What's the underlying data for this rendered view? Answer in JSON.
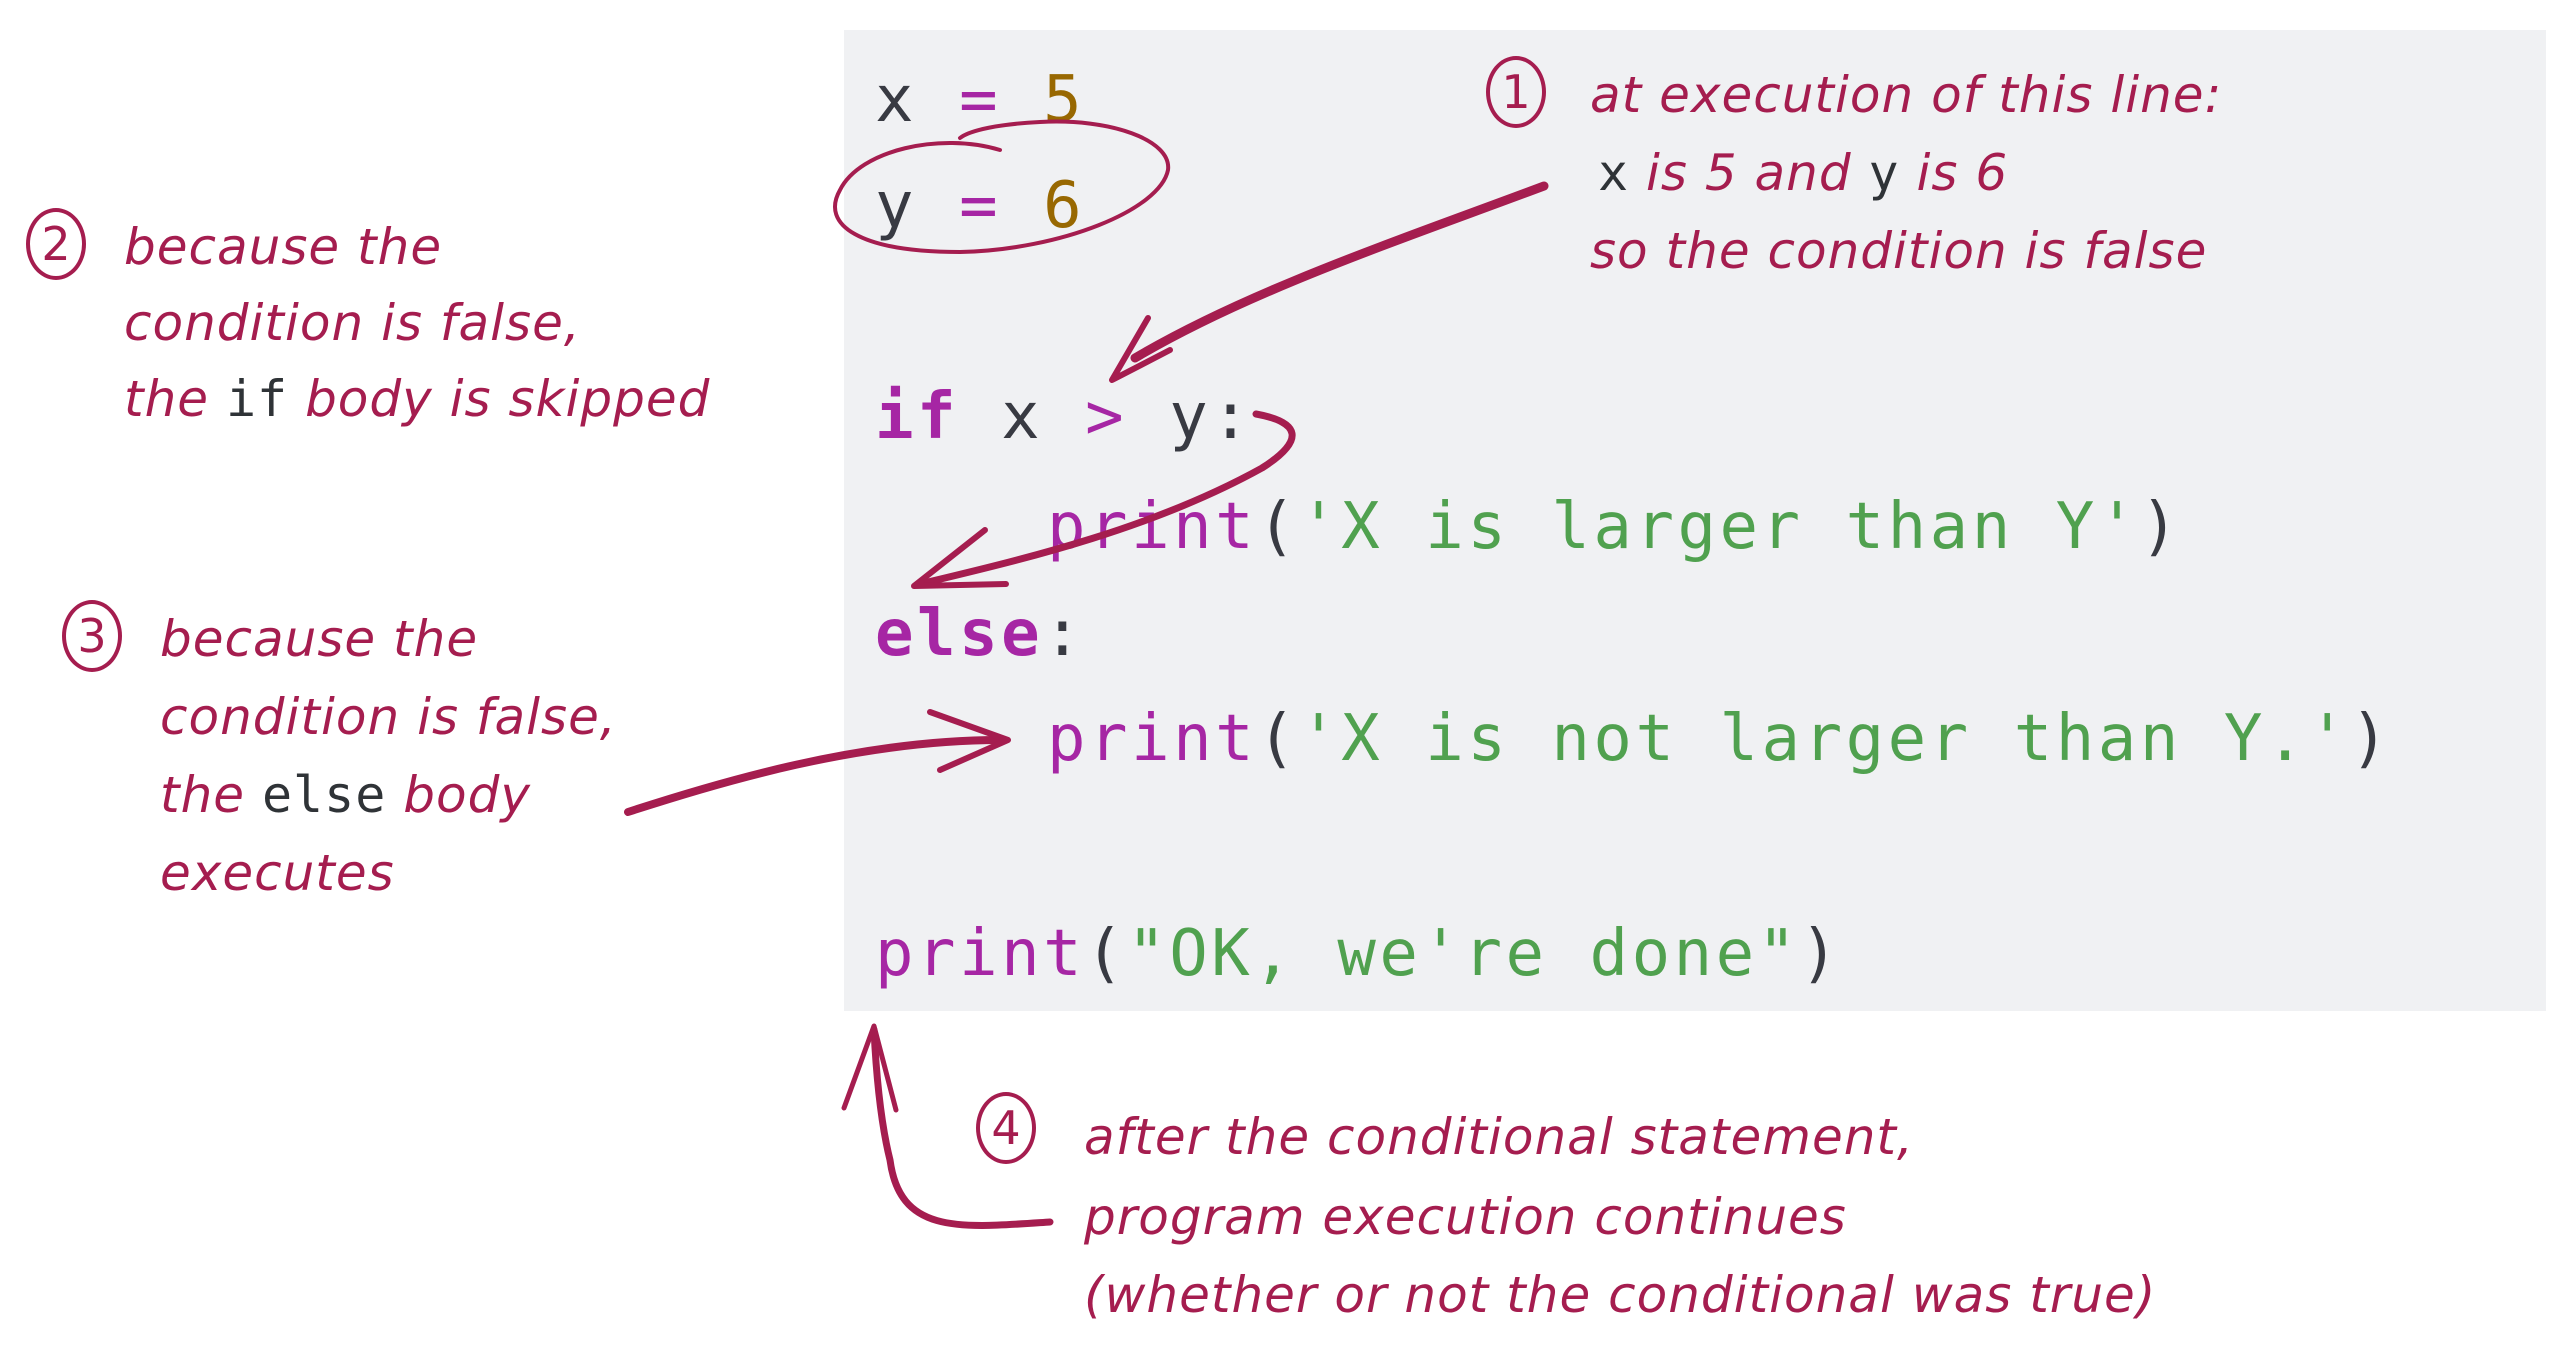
{
  "code": {
    "lines": [
      {
        "tokens": [
          {
            "t": "x",
            "c": "punc"
          },
          {
            "t": " "
          },
          {
            "t": "=",
            "c": "op"
          },
          {
            "t": " "
          },
          {
            "t": "5",
            "c": "num"
          }
        ]
      },
      {
        "tokens": [
          {
            "t": "y",
            "c": "punc"
          },
          {
            "t": " "
          },
          {
            "t": "=",
            "c": "op"
          },
          {
            "t": " "
          },
          {
            "t": "6",
            "c": "num"
          }
        ]
      },
      {
        "tokens": [
          {
            "t": "if",
            "c": "kw"
          },
          {
            "t": " x "
          },
          {
            "t": ">",
            "c": "op"
          },
          {
            "t": " y:"
          }
        ]
      },
      {
        "tokens": [
          {
            "t": "print",
            "c": "fn"
          },
          {
            "t": "(",
            "c": "punc"
          },
          {
            "t": "'X is larger than Y'",
            "c": "str"
          },
          {
            "t": ")",
            "c": "punc"
          }
        ]
      },
      {
        "tokens": [
          {
            "t": "else",
            "c": "kw"
          },
          {
            "t": ":",
            "c": "punc"
          }
        ]
      },
      {
        "tokens": [
          {
            "t": "print",
            "c": "fn"
          },
          {
            "t": "(",
            "c": "punc"
          },
          {
            "t": "'X is not larger than Y.'",
            "c": "str"
          },
          {
            "t": ")",
            "c": "punc"
          }
        ]
      },
      {
        "tokens": [
          {
            "t": "print",
            "c": "fn"
          },
          {
            "t": "(",
            "c": "punc"
          },
          {
            "t": "\"OK, we're done\"",
            "c": "str"
          },
          {
            "t": ")",
            "c": "punc"
          }
        ]
      }
    ]
  },
  "annotations": {
    "a1": {
      "number": "1",
      "line1": "at execution of this line:",
      "line2_var_x": "x",
      "line2_mid": " is 5 and ",
      "line2_var_y": "y",
      "line2_end": " is 6",
      "line3": "so the condition is false"
    },
    "a2": {
      "number": "2",
      "line1": "because the",
      "line2": "condition is false,",
      "line3_start": "the ",
      "line3_code": "if",
      "line3_end": " body is skipped"
    },
    "a3": {
      "number": "3",
      "line1": "because the",
      "line2": "condition is false,",
      "line3_start": "the ",
      "line3_code": "else",
      "line3_end": " body",
      "line4": "executes"
    },
    "a4": {
      "number": "4",
      "line1": "after the conditional statement,",
      "line2": "program execution continues",
      "line3": "(whether or not the conditional was true)"
    }
  },
  "colors": {
    "annotation_ink": "#a51d4f",
    "code_background": "#f0f1f3",
    "keyword": "#a626a4",
    "string": "#50a14f",
    "number": "#986801",
    "text": "#383a42"
  }
}
